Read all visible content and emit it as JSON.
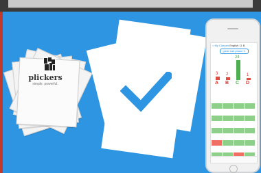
{
  "cards": {
    "brand": "plickers",
    "tagline": "simple. powerful."
  },
  "phone": {
    "nav_back": "< My Classes",
    "nav_title": "English 11 B",
    "pill": "great bad phase 3",
    "bars": [
      {
        "letter": "A",
        "count": "3",
        "color": "#e04b3f",
        "level": 0.14
      },
      {
        "letter": "B",
        "count": "2",
        "color": "#e04b3f",
        "level": 0.09
      },
      {
        "letter": "C",
        "count": "24",
        "color": "#4cb050",
        "level": 1.0
      },
      {
        "letter": "D",
        "count": "1",
        "color": "#e04b3f",
        "level": 0.05
      }
    ]
  }
}
